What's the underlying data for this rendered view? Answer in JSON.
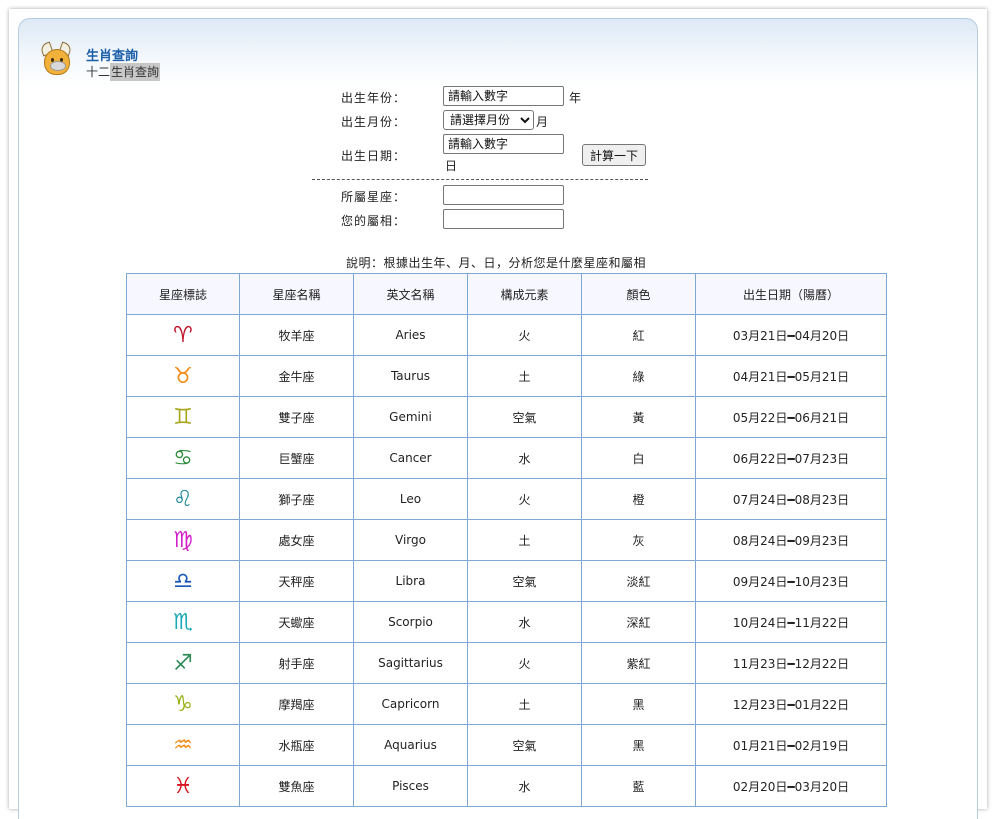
{
  "header": {
    "title": "生肖查詢",
    "subtitle_prefix": "十二",
    "subtitle_highlight": "生肖查詢"
  },
  "form": {
    "birth_year_label": "出生年份：",
    "birth_year_placeholder": "請輸入數字",
    "birth_year_unit": "年",
    "birth_month_label": "出生月份：",
    "birth_month_selected": "請選擇月份",
    "birth_month_unit": "月",
    "birth_day_label": "出生日期：",
    "birth_day_placeholder": "請輸入數字",
    "birth_day_unit": "日",
    "calc_button": "計算一下",
    "star_sign_label": "所屬星座：",
    "star_sign_value": "",
    "zodiac_label": "您的屬相：",
    "zodiac_value": ""
  },
  "description": "說明：根據出生年、月、日，分析您是什麼星座和屬相",
  "table": {
    "headers": [
      "星座標誌",
      "星座名稱",
      "英文名稱",
      "構成元素",
      "顏色",
      "出生日期（陽曆）"
    ],
    "rows": [
      {
        "symbol": "♈",
        "symbol_color": "#c0162c",
        "name": "牧羊座",
        "english": "Aries",
        "element": "火",
        "color": "紅",
        "dates": "03月21日━04月20日"
      },
      {
        "symbol": "♉",
        "symbol_color": "#f08c1a",
        "name": "金牛座",
        "english": "Taurus",
        "element": "土",
        "color": "綠",
        "dates": "04月21日━05月21日"
      },
      {
        "symbol": "♊",
        "symbol_color": "#a7a51c",
        "name": "雙子座",
        "english": "Gemini",
        "element": "空氣",
        "color": "黃",
        "dates": "05月22日━06月21日"
      },
      {
        "symbol": "♋",
        "symbol_color": "#2e8b3a",
        "name": "巨蟹座",
        "english": "Cancer",
        "element": "水",
        "color": "白",
        "dates": "06月22日━07月23日"
      },
      {
        "symbol": "♌",
        "symbol_color": "#1f8a99",
        "name": "獅子座",
        "english": "Leo",
        "element": "火",
        "color": "橙",
        "dates": "07月24日━08月23日"
      },
      {
        "symbol": "♍",
        "symbol_color": "#d21fc8",
        "name": "處女座",
        "english": "Virgo",
        "element": "土",
        "color": "灰",
        "dates": "08月24日━09月23日"
      },
      {
        "symbol": "♎",
        "symbol_color": "#1a56b5",
        "name": "天秤座",
        "english": "Libra",
        "element": "空氣",
        "color": "淡紅",
        "dates": "09月24日━10月23日"
      },
      {
        "symbol": "♏",
        "symbol_color": "#19a8b8",
        "name": "天蠍座",
        "english": "Scorpio",
        "element": "水",
        "color": "深紅",
        "dates": "10月24日━11月22日"
      },
      {
        "symbol": "♐",
        "symbol_color": "#2e8b57",
        "name": "射手座",
        "english": "Sagittarius",
        "element": "火",
        "color": "紫紅",
        "dates": "11月23日━12月22日"
      },
      {
        "symbol": "♑",
        "symbol_color": "#9ab21c",
        "name": "摩羯座",
        "english": "Capricorn",
        "element": "土",
        "color": "黑",
        "dates": "12月23日━01月22日"
      },
      {
        "symbol": "♒",
        "symbol_color": "#f08c1a",
        "name": "水瓶座",
        "english": "Aquarius",
        "element": "空氣",
        "color": "黑",
        "dates": "01月21日━02月19日"
      },
      {
        "symbol": "♓",
        "symbol_color": "#d4161e",
        "name": "雙魚座",
        "english": "Pisces",
        "element": "水",
        "color": "藍",
        "dates": "02月20日━03月20日"
      }
    ]
  }
}
